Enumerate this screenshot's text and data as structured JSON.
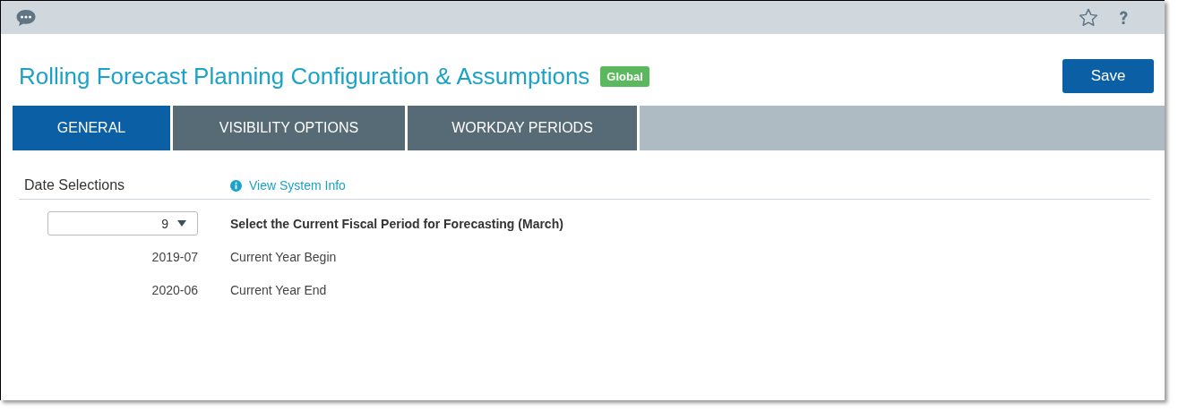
{
  "page": {
    "title": "Rolling Forecast Planning Configuration & Assumptions",
    "scope_badge": "Global",
    "save_button": "Save"
  },
  "tabs": [
    {
      "label": "GENERAL",
      "selected": true
    },
    {
      "label": "VISIBILITY OPTIONS",
      "selected": false
    },
    {
      "label": "WORKDAY PERIODS",
      "selected": false
    }
  ],
  "section": {
    "title": "Date Selections",
    "info_link": "View System Info"
  },
  "rows": [
    {
      "kind": "select",
      "value": "9",
      "label": "Select the Current Fiscal Period for Forecasting (March)"
    },
    {
      "kind": "value",
      "value": "2019-07",
      "label": "Current Year Begin"
    },
    {
      "kind": "value",
      "value": "2020-06",
      "label": "Current Year End"
    }
  ]
}
